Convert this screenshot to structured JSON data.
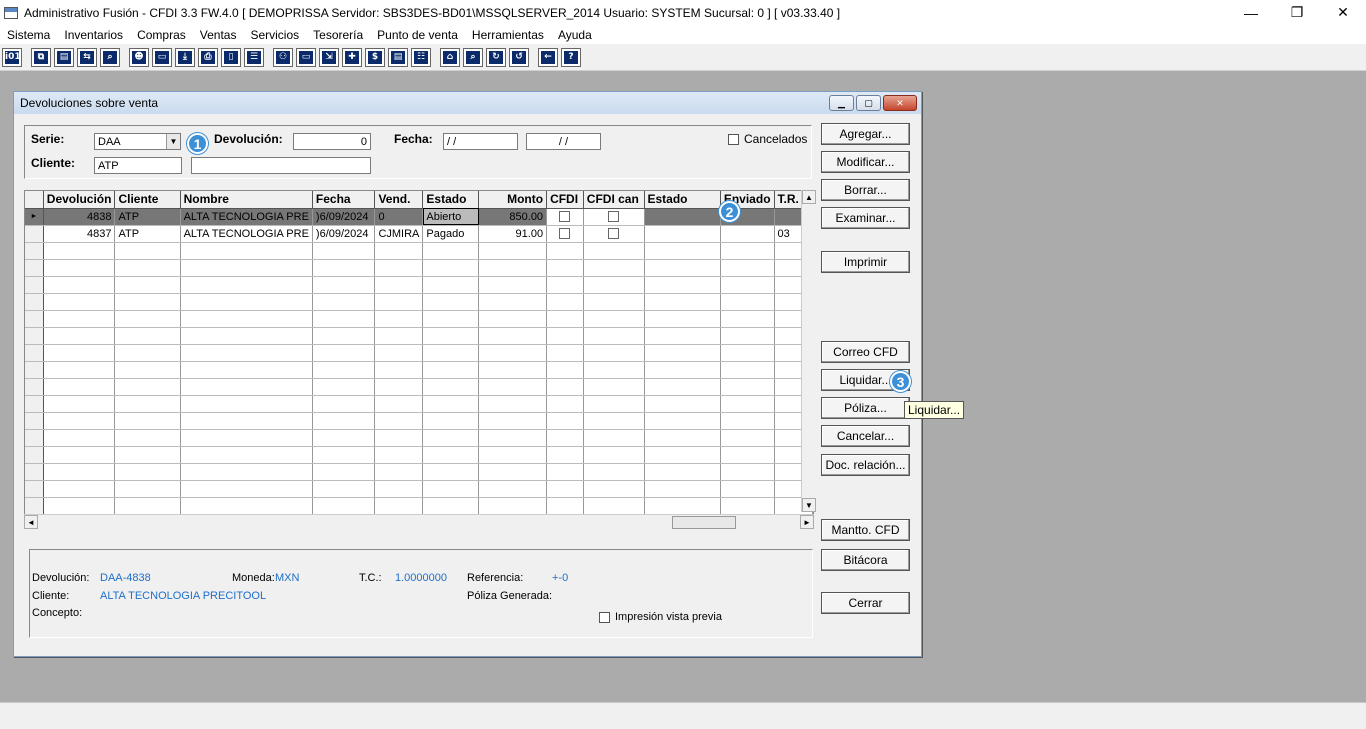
{
  "window": {
    "title": "Administrativo Fusión - CFDI 3.3 FW.4.0 [ DEMOPRISSA   Servidor: SBS3DES-BD01\\MSSQLSERVER_2014   Usuario: SYSTEM     Sucursal: 0 ] [ v03.33.40 ]",
    "minimize": "—",
    "restore": "❐",
    "close": "✕"
  },
  "menu": [
    "Sistema",
    "Inventarios",
    "Compras",
    "Ventas",
    "Servicios",
    "Tesorería",
    "Punto de venta",
    "Herramientas",
    "Ayuda"
  ],
  "toolbar": {
    "groups": [
      [
        {
          "icon": "info-icon",
          "glyph": "i01"
        }
      ],
      [
        {
          "icon": "copy-icon",
          "glyph": "⧉"
        },
        {
          "icon": "clipboard-icon",
          "glyph": "▤"
        },
        {
          "icon": "transfer-icon",
          "glyph": "⇆"
        },
        {
          "icon": "search-icon",
          "glyph": "⌕"
        }
      ],
      [
        {
          "icon": "user-icon",
          "glyph": "☻"
        },
        {
          "icon": "folder-icon",
          "glyph": "▭"
        },
        {
          "icon": "import-icon",
          "glyph": "⤓"
        },
        {
          "icon": "printer-icon",
          "glyph": "⎙"
        },
        {
          "icon": "document-icon",
          "glyph": "▯"
        },
        {
          "icon": "list-icon",
          "glyph": "☰"
        }
      ],
      [
        {
          "icon": "users-icon",
          "glyph": "⚇"
        },
        {
          "icon": "box-icon",
          "glyph": "▭"
        },
        {
          "icon": "export-icon",
          "glyph": "⇲"
        },
        {
          "icon": "add-icon",
          "glyph": "✚"
        },
        {
          "icon": "money-icon",
          "glyph": "$"
        },
        {
          "icon": "report-icon",
          "glyph": "▤"
        },
        {
          "icon": "table-icon",
          "glyph": "☷"
        }
      ],
      [
        {
          "icon": "home-icon",
          "glyph": "⌂"
        },
        {
          "icon": "zoom-icon",
          "glyph": "⌕"
        },
        {
          "icon": "refresh-icon",
          "glyph": "↻"
        },
        {
          "icon": "undo-icon",
          "glyph": "↺"
        }
      ],
      [
        {
          "icon": "back-icon",
          "glyph": "←"
        },
        {
          "icon": "help-icon",
          "glyph": "?"
        }
      ]
    ]
  },
  "dialog": {
    "title": "Devoluciones sobre venta",
    "filters": {
      "serie_label": "Serie:",
      "serie_value": "DAA",
      "devolucion_label": "Devolución:",
      "devolucion_value": "0",
      "fecha_label": "Fecha:",
      "fecha_from": " / /",
      "fecha_to": " / /",
      "cancelados_label": "Cancelados",
      "cliente_label": "Cliente:",
      "cliente_value": "ATP",
      "cliente_name_value": ""
    },
    "buttons": {
      "agregar": "Agregar...",
      "modificar": "Modificar...",
      "borrar": "Borrar...",
      "examinar": "Examinar...",
      "imprimir": "Imprimir",
      "correo": "Correo CFD",
      "liquidar": "Liquidar...",
      "poliza": "Póliza...",
      "cancelar": "Cancelar...",
      "doc_relacion": "Doc. relación...",
      "mantto": "Mantto. CFD",
      "bitacora": "Bitácora",
      "cerrar": "Cerrar"
    },
    "grid": {
      "columns": [
        "Devolución",
        "Cliente",
        "Nombre",
        "Fecha",
        "Vend.",
        "Estado",
        "Monto",
        "CFDI",
        "CFDI can",
        "Estado",
        "Enviado",
        "T.R."
      ],
      "rows": [
        {
          "devolucion": "4838",
          "cliente": "ATP",
          "nombre": "ALTA TECNOLOGIA PRE",
          "fecha": ")6/09/2024",
          "vend": "0",
          "estado": "Abierto",
          "monto": "850.00",
          "estado2": "",
          "enviado": "",
          "tr": ""
        },
        {
          "devolucion": "4837",
          "cliente": "ATP",
          "nombre": "ALTA TECNOLOGIA PRE",
          "fecha": ")6/09/2024",
          "vend": "CJMIRA",
          "estado": "Pagado",
          "monto": "91.00",
          "estado2": "",
          "enviado": "",
          "tr": "03"
        }
      ],
      "row_indicator": "►",
      "scroll_up": "▲",
      "scroll_down": "▼",
      "scroll_left": "◄",
      "scroll_right": "►"
    },
    "info": {
      "devolucion_label": "Devolución:",
      "devolucion_value": "DAA-4838",
      "moneda_label": "Moneda:",
      "moneda_value": "MXN",
      "tc_label": "T.C.:",
      "tc_value": "1.0000000",
      "referencia_label": "Referencia:",
      "referencia_value": "+-0",
      "cliente_label": "Cliente:",
      "cliente_value": "ALTA TECNOLOGIA PRECITOOL",
      "poliza_label": "Póliza Generada:",
      "concepto_label": "Concepto:",
      "impresion_label": "Impresión vista previa"
    }
  },
  "markers": [
    "1",
    "2",
    "3"
  ],
  "tooltip": "Liquidar...",
  "accent_color": "#3d8fd6"
}
